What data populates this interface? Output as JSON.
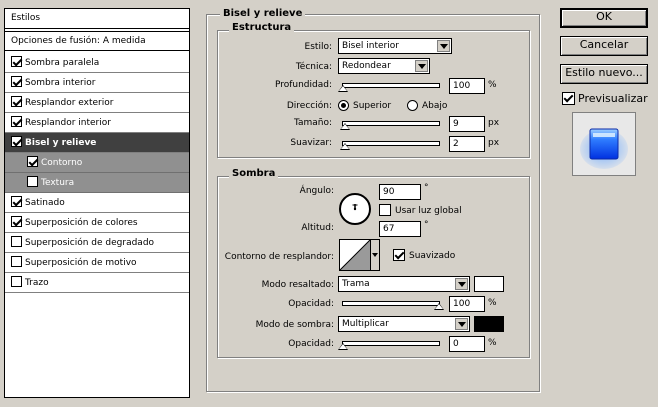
{
  "list": {
    "header": "Estilos",
    "blend": "Opciones de fusión: A medida",
    "items": [
      {
        "label": "Sombra paralela",
        "checked": true
      },
      {
        "label": "Sombra interior",
        "checked": true
      },
      {
        "label": "Resplandor exterior",
        "checked": true
      },
      {
        "label": "Resplandor interior",
        "checked": true
      },
      {
        "label": "Bisel y relieve",
        "checked": true
      },
      {
        "label": "Contorno",
        "checked": true
      },
      {
        "label": "Textura",
        "checked": false
      },
      {
        "label": "Satinado",
        "checked": true
      },
      {
        "label": "Superposición de colores",
        "checked": true
      },
      {
        "label": "Superposición de degradado",
        "checked": false
      },
      {
        "label": "Superposición de motivo",
        "checked": false
      },
      {
        "label": "Trazo",
        "checked": false
      }
    ]
  },
  "panel": {
    "title": "Bisel y relieve",
    "structure": {
      "title": "Estructura",
      "style_label": "Estilo:",
      "style_value": "Bisel interior",
      "technique_label": "Técnica:",
      "technique_value": "Redondear",
      "depth_label": "Profundidad:",
      "depth_value": "100",
      "depth_unit": "%",
      "direction_label": "Dirección:",
      "dir_up": "Superior",
      "dir_down": "Abajo",
      "size_label": "Tamaño:",
      "size_value": "9",
      "size_unit": "px",
      "soften_label": "Suavizar:",
      "soften_value": "2",
      "soften_unit": "px"
    },
    "shading": {
      "title": "Sombra",
      "angle_label": "Ángulo:",
      "angle_value": "90",
      "angle_unit": "°",
      "global_light": "Usar luz global",
      "altitude_label": "Altitud:",
      "altitude_value": "67",
      "altitude_unit": "°",
      "gloss_label": "Contorno de resplandor:",
      "antialias": "Suavizado",
      "highlight_label": "Modo resaltado:",
      "highlight_value": "Trama",
      "highlight_color": "#ffffff",
      "hl_opacity_label": "Opacidad:",
      "hl_opacity_value": "100",
      "hl_opacity_unit": "%",
      "shadow_label": "Modo de sombra:",
      "shadow_value": "Multiplicar",
      "shadow_color": "#000000",
      "sh_opacity_label": "Opacidad:",
      "sh_opacity_value": "0",
      "sh_opacity_unit": "%"
    }
  },
  "buttons": {
    "ok": "OK",
    "cancel": "Cancelar",
    "new_style": "Estilo nuevo...",
    "preview": "Previsualizar"
  },
  "slider_levels": {
    "depth": 0.0,
    "size": 0.02,
    "soften": 0.02,
    "hl_opacity": 1.0,
    "sh_opacity": 0.0
  }
}
